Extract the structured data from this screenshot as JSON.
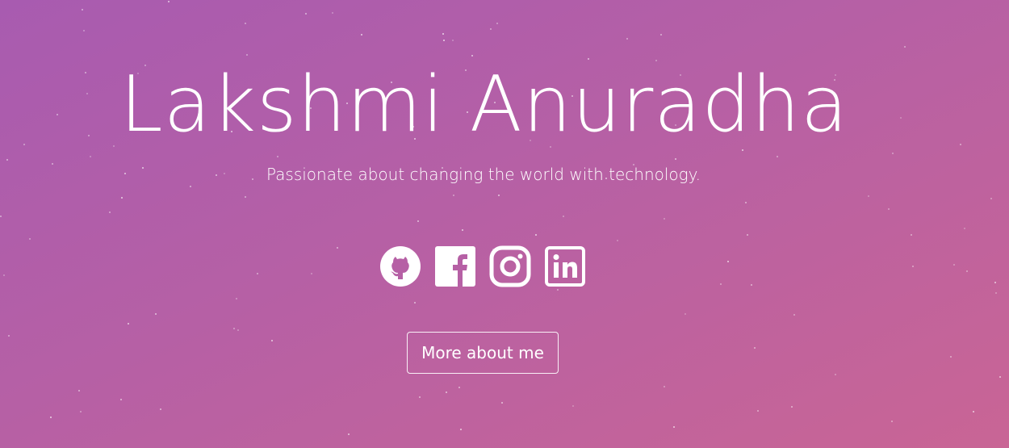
{
  "hero": {
    "name": "Lakshmi Anuradha",
    "tagline": "Passionate about changing the world with technology.",
    "button_label": "More about me"
  },
  "socials": [
    {
      "icon": "github-icon"
    },
    {
      "icon": "facebook-icon"
    },
    {
      "icon": "instagram-icon"
    },
    {
      "icon": "linkedin-icon"
    }
  ],
  "colors": {
    "gradient_start": "#a85bb0",
    "gradient_end": "#c96595",
    "text": "#ffffff"
  }
}
